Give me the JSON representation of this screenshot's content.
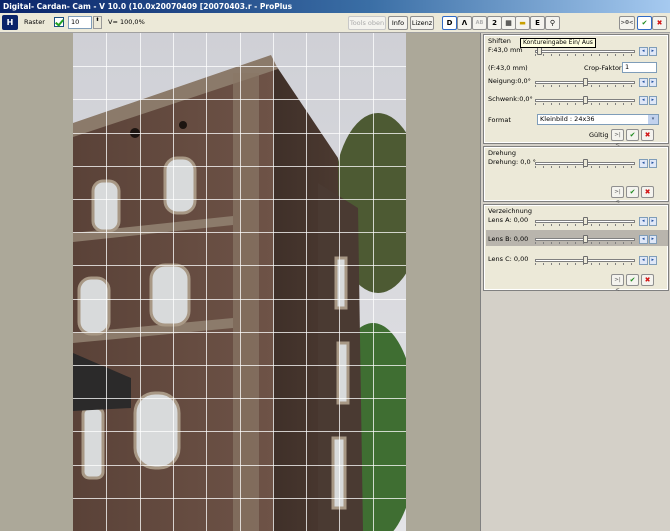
{
  "window": {
    "title": "Digital- Cardan- Cam - V 10.0 (10.0x20070409 [20070403.r - ProPlus"
  },
  "toolbar": {
    "raster_label": "Raster",
    "raster_value": "10",
    "view_value": "V= 100,0%",
    "buttons": {
      "tools_oben": "Tools oben",
      "info": "Info",
      "lizenz": "Lizenz"
    },
    "mode_buttons": [
      "D",
      "2",
      "E"
    ],
    "nav_prev": ">0<"
  },
  "tooltip": "Kontureingabe Ein/ Aus",
  "shiften": {
    "title": "Shiften",
    "focal_label": "F:43,0 mm",
    "focal_equiv_label": "(F:43,0 mm)",
    "crop_label": "Crop-Faktor",
    "crop_value": "1",
    "neigung_label": "Neigung:0,0°",
    "schwenk_label": "Schwenk:0,0°",
    "format_label": "Format",
    "format_value": "Kleinbild : 24x36",
    "gueltig_label": "Gültig"
  },
  "drehung": {
    "title": "Drehung",
    "drehung_label": "Drehung: 0,0 °"
  },
  "verzeichnung": {
    "title": "Verzeichnung",
    "lens_a_label": "Lens A: 0,00",
    "lens_b_label": "Lens B: 0,00",
    "lens_c_label": "Lens C: 0,00"
  },
  "actions": {
    "reset": ">|<",
    "ok": "✔",
    "cancel": "✖"
  },
  "arrows": {
    "left": "◂",
    "right": "▸"
  },
  "spin": "⬍",
  "dropdown": "▾",
  "toolbar_icons": {
    "logo": "H",
    "tool_icon": "ⴷ",
    "grid_icon": "▦",
    "ruler_icon": "▬",
    "zoom_icon": "⚲",
    "ab_icon": "AB"
  },
  "grid": {
    "rows": 15,
    "cols": 10
  }
}
